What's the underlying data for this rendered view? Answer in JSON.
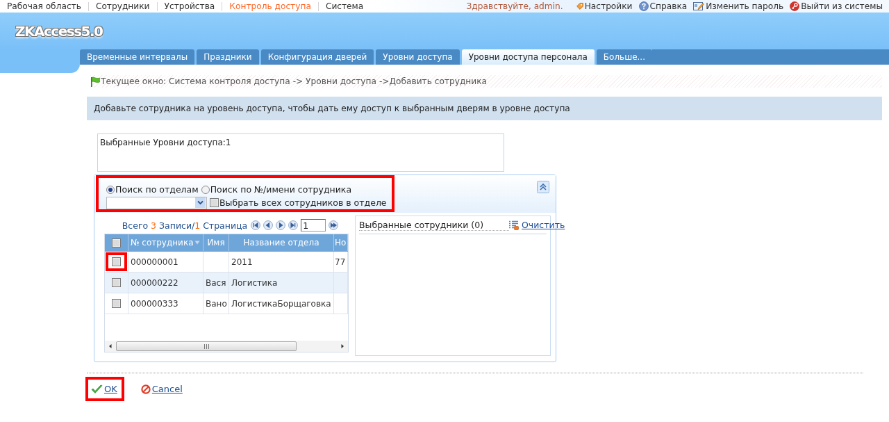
{
  "top_nav": {
    "items": [
      {
        "label": "Рабочая область",
        "selected": false
      },
      {
        "label": "Сотрудники",
        "selected": false
      },
      {
        "label": "Устройства",
        "selected": false
      },
      {
        "label": "Контроль доступа",
        "selected": true
      },
      {
        "label": "Система",
        "selected": false
      }
    ],
    "greeting": "Здравствуйте, admin.",
    "links": [
      {
        "label": "Настройки",
        "kind": "settings"
      },
      {
        "label": "Справка",
        "kind": "help"
      },
      {
        "label": "Изменить пароль",
        "kind": "password"
      },
      {
        "label": "Выйти из системы",
        "kind": "logout"
      }
    ]
  },
  "logo": "ZKAccess5.0",
  "tabs": [
    {
      "label": "Временные интервалы",
      "selected": false
    },
    {
      "label": "Праздники",
      "selected": false
    },
    {
      "label": "Конфигурация дверей",
      "selected": false
    },
    {
      "label": "Уровни доступа",
      "selected": false
    },
    {
      "label": "Уровни доступа персонала",
      "selected": true
    },
    {
      "label": "Больше...",
      "selected": false
    }
  ],
  "breadcrumb": "Текущее окно: Система контроля доступа -> Уровни доступа ->Добавить сотрудника",
  "info": "Добавьте сотрудника на уровень доступа, чтобы дать ему доступ к выбранным дверям в уровне доступа",
  "selected_levels": "Выбранные Уровни доступа:1",
  "search": {
    "highlighted": true,
    "modes": [
      {
        "label": "Поиск по отделам",
        "selected": true
      },
      {
        "label": "Поиск по №/имени сотрудника",
        "selected": false
      }
    ],
    "select_all": {
      "label": "Выбрать всех сотрудников в отделе",
      "checked": false
    }
  },
  "employees": {
    "summary": [
      {
        "text": "Всего ",
        "kind": "label"
      },
      {
        "text": "3",
        "kind": "count"
      },
      {
        "text": " Записи/",
        "kind": "label"
      },
      {
        "text": "1",
        "kind": "count"
      },
      {
        "text": " Страница",
        "kind": "label"
      }
    ],
    "page": "1",
    "all_checked": false,
    "columns": [
      {
        "label": "№ сотрудника",
        "sort_arrow": true
      },
      {
        "label": "Имя",
        "sort_arrow": false
      },
      {
        "label": "Название отдела",
        "sort_arrow": false
      },
      {
        "label": "Но",
        "sort_arrow": false
      }
    ],
    "rows": [
      {
        "checked": false,
        "highlighted": true,
        "employee_no": "000000001",
        "department": "2011",
        "column_4": "77"
      },
      {
        "checked": false,
        "highlighted": false,
        "employee_no": "000000222",
        "name": "Вася",
        "department": "Логистика"
      },
      {
        "checked": false,
        "highlighted": false,
        "employee_no": "000000333",
        "name": "Вано",
        "department": "ЛогистикаБорщаговка"
      }
    ]
  },
  "selected_employees": {
    "title": "Выбранные сотрудники (0)",
    "clear": "Очистить"
  },
  "actions": [
    {
      "label": "OK",
      "kind": "ok",
      "highlighted": true
    },
    {
      "label": "Cancel",
      "kind": "cancel",
      "highlighted": false
    }
  ]
}
